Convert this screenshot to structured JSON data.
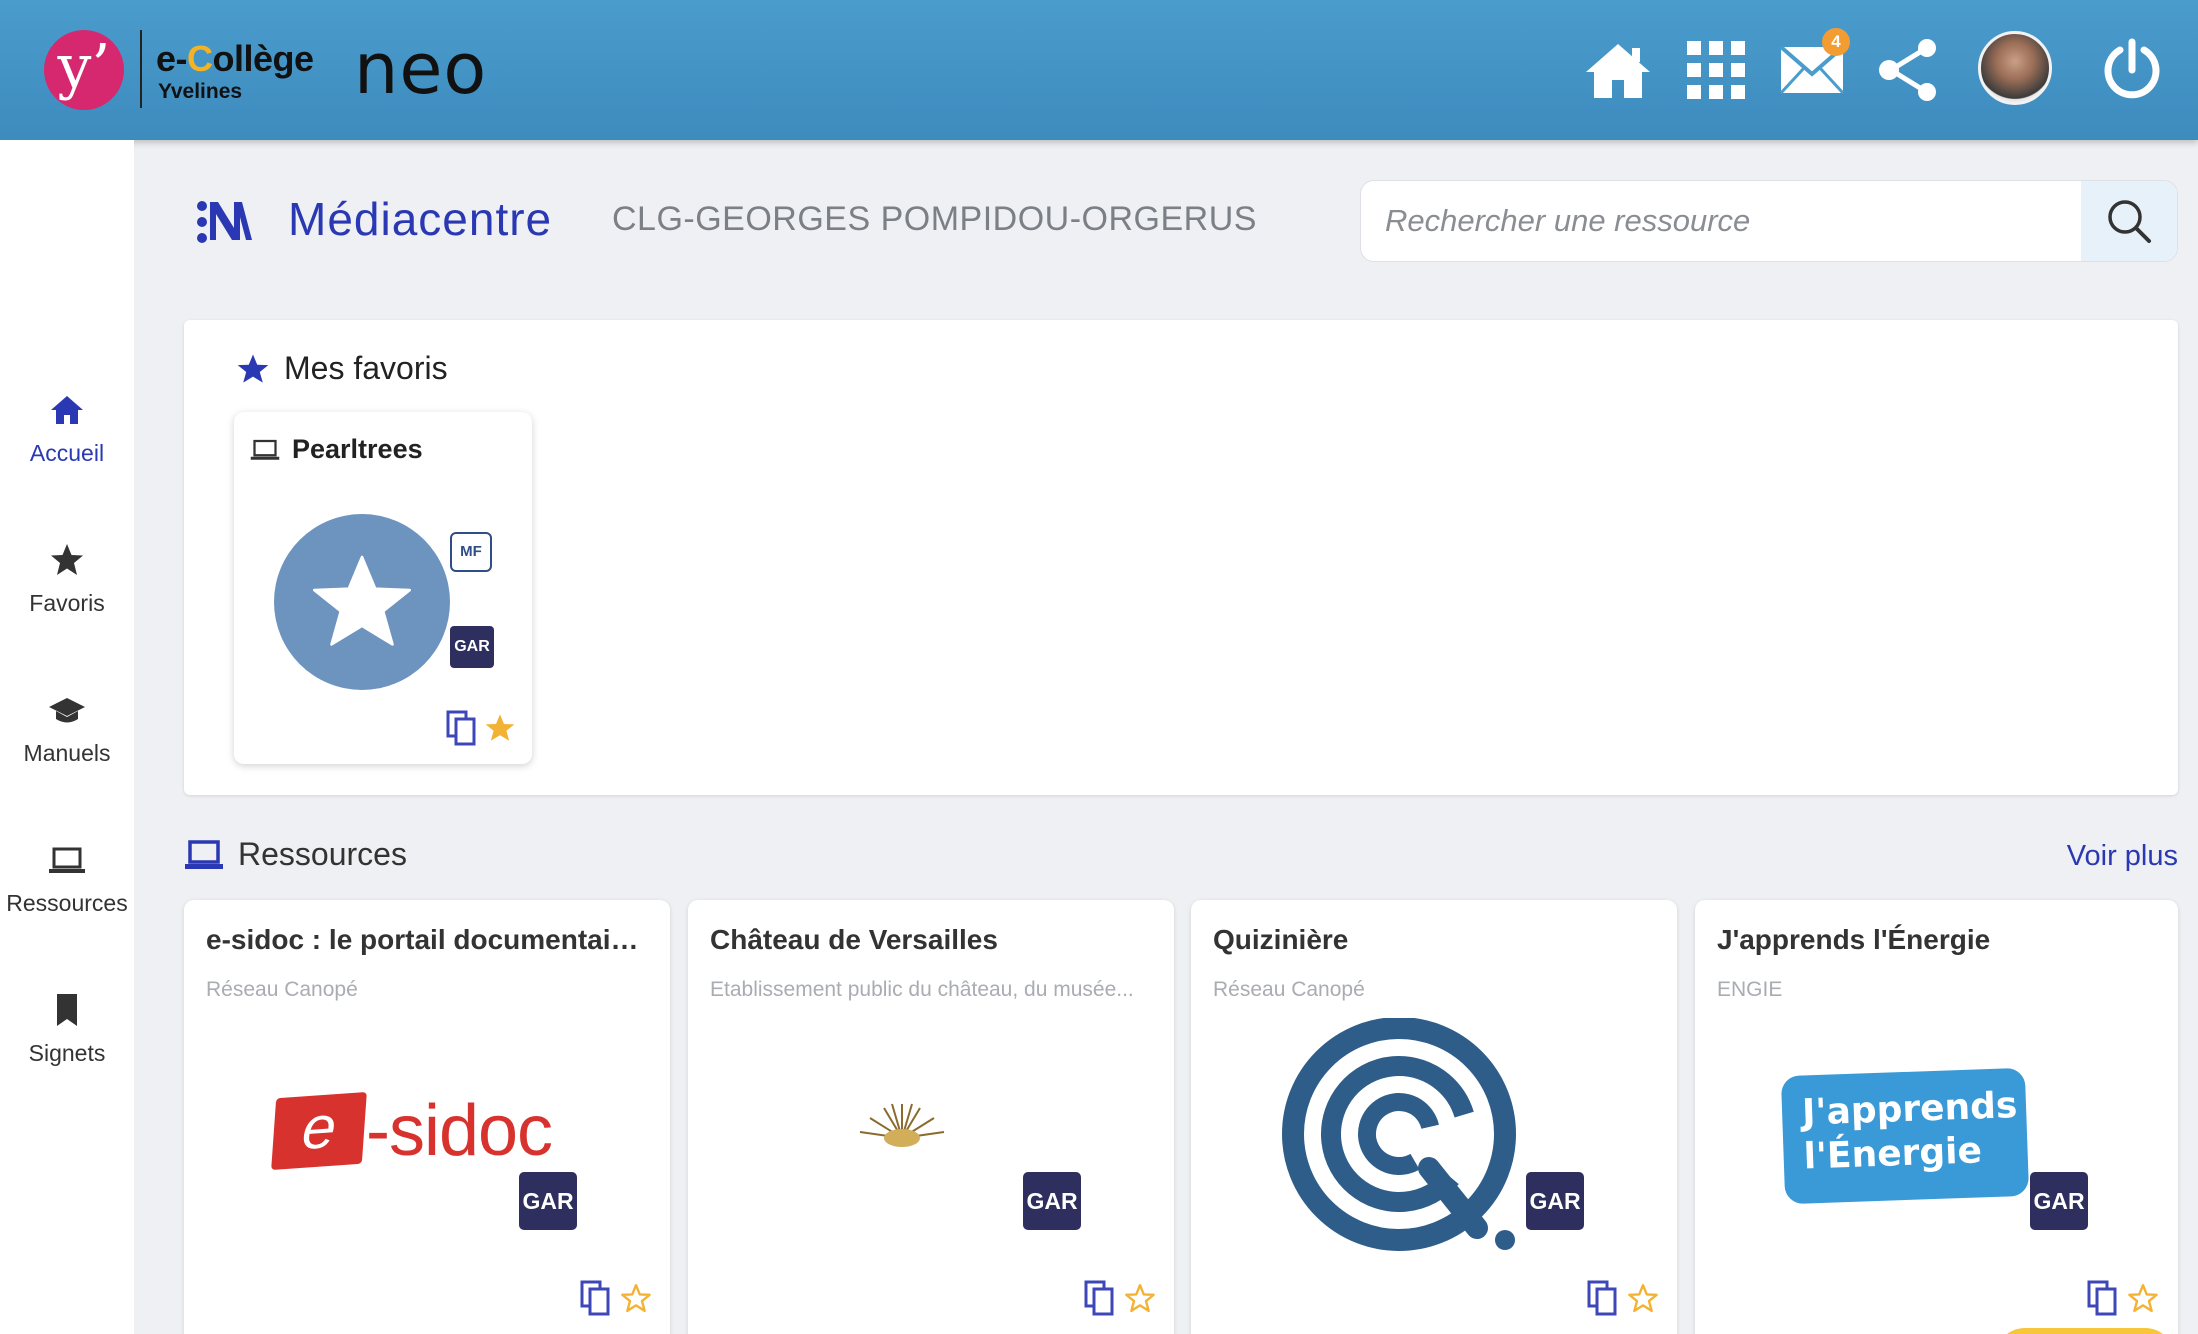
{
  "topbar": {
    "brand_y": "y’",
    "brand_e": "e-",
    "brand_c": "C",
    "brand_rest": "ollège",
    "brand_sub": "Yvelines",
    "brand_neo": "neo",
    "mail_badge": "4",
    "icons": [
      "home-icon",
      "apps-grid-icon",
      "mail-icon",
      "share-icon",
      "avatar",
      "power-icon"
    ]
  },
  "sidebar": {
    "items": [
      {
        "label": "Accueil",
        "icon": "home-icon",
        "active": true
      },
      {
        "label": "Favoris",
        "icon": "star-icon"
      },
      {
        "label": "Manuels",
        "icon": "graduation-cap-icon"
      },
      {
        "label": "Ressources",
        "icon": "laptop-icon"
      },
      {
        "label": "Signets",
        "icon": "bookmark-icon"
      }
    ]
  },
  "header": {
    "title": "Médiacentre",
    "school": "CLG-GEORGES POMPIDOU-ORGERUS",
    "search_placeholder": "Rechercher une ressource"
  },
  "favorites": {
    "title": "Mes favoris",
    "cards": [
      {
        "name": "Pearltrees",
        "tag_mf": "MF",
        "tag_gar": "GAR"
      }
    ]
  },
  "resources": {
    "title": "Ressources",
    "more": "Voir plus",
    "cards": [
      {
        "name": "e-sidoc : le portail documentaire ...",
        "publisher": "Réseau Canopé",
        "gar": "GAR",
        "logo_e": "e",
        "logo_rest": "-sidoc"
      },
      {
        "name": "Château de Versailles",
        "publisher": "Etablissement public du château, du musée...",
        "gar": "GAR"
      },
      {
        "name": "Quizinière",
        "publisher": "Réseau Canopé",
        "gar": "GAR"
      },
      {
        "name": "J'apprends l'Énergie",
        "publisher": "ENGIE",
        "gar": "GAR",
        "logo_line1": "J'apprends",
        "logo_line2": "l'Énergie"
      }
    ]
  },
  "colors": {
    "accent": "#2a39b3",
    "topbar": "#4a9ccd",
    "gar": "#2e2f5e",
    "favorite_star": "#f3b234"
  }
}
